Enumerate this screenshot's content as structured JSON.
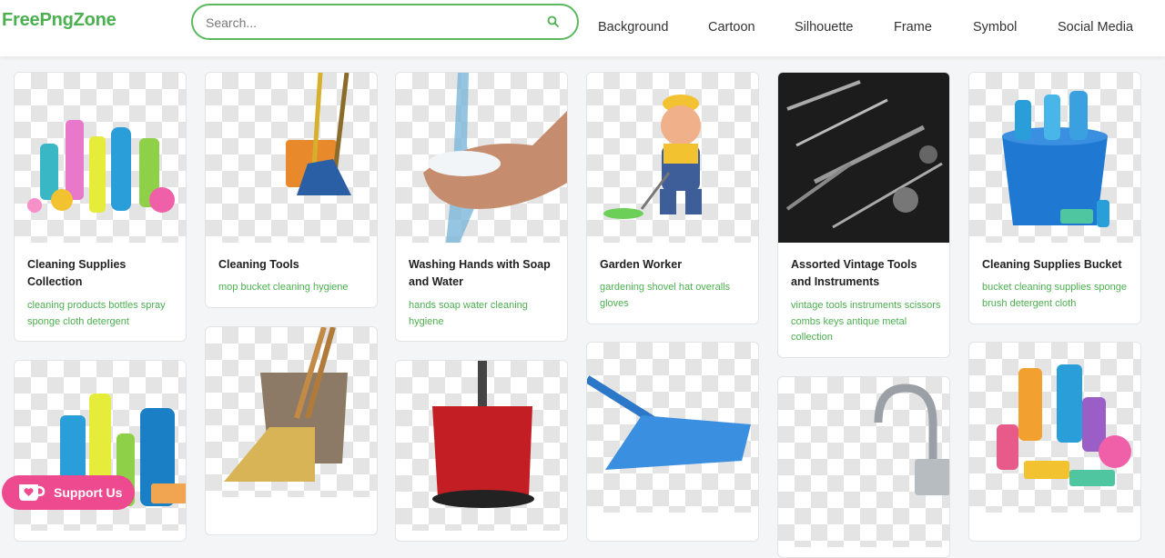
{
  "header": {
    "logo": "FreePngZone",
    "search_placeholder": "Search...",
    "nav": [
      {
        "label": "Background"
      },
      {
        "label": "Cartoon"
      },
      {
        "label": "Silhouette"
      },
      {
        "label": "Frame"
      },
      {
        "label": "Symbol"
      },
      {
        "label": "Social Media"
      }
    ]
  },
  "cards": [
    {
      "title": "Cleaning Supplies Collection",
      "tags": "cleaning products bottles spray sponge cloth detergent"
    },
    {
      "title": "Cleaning Tools",
      "tags": "mop bucket cleaning hygiene"
    },
    {
      "title": "Washing Hands with Soap and Water",
      "tags": "hands soap water cleaning hygiene"
    },
    {
      "title": "Garden Worker",
      "tags": "gardening shovel hat overalls gloves"
    },
    {
      "title": "Assorted Vintage Tools and Instruments",
      "tags": "vintage tools instruments scissors combs keys antique metal collection"
    },
    {
      "title": "Cleaning Supplies Bucket",
      "tags": "bucket cleaning supplies sponge brush detergent cloth"
    }
  ],
  "support": {
    "label": "Support Us",
    "icon": "ko-fi-cup-icon"
  },
  "colors": {
    "brand": "#4caf50",
    "support": "#ee4a8f"
  }
}
